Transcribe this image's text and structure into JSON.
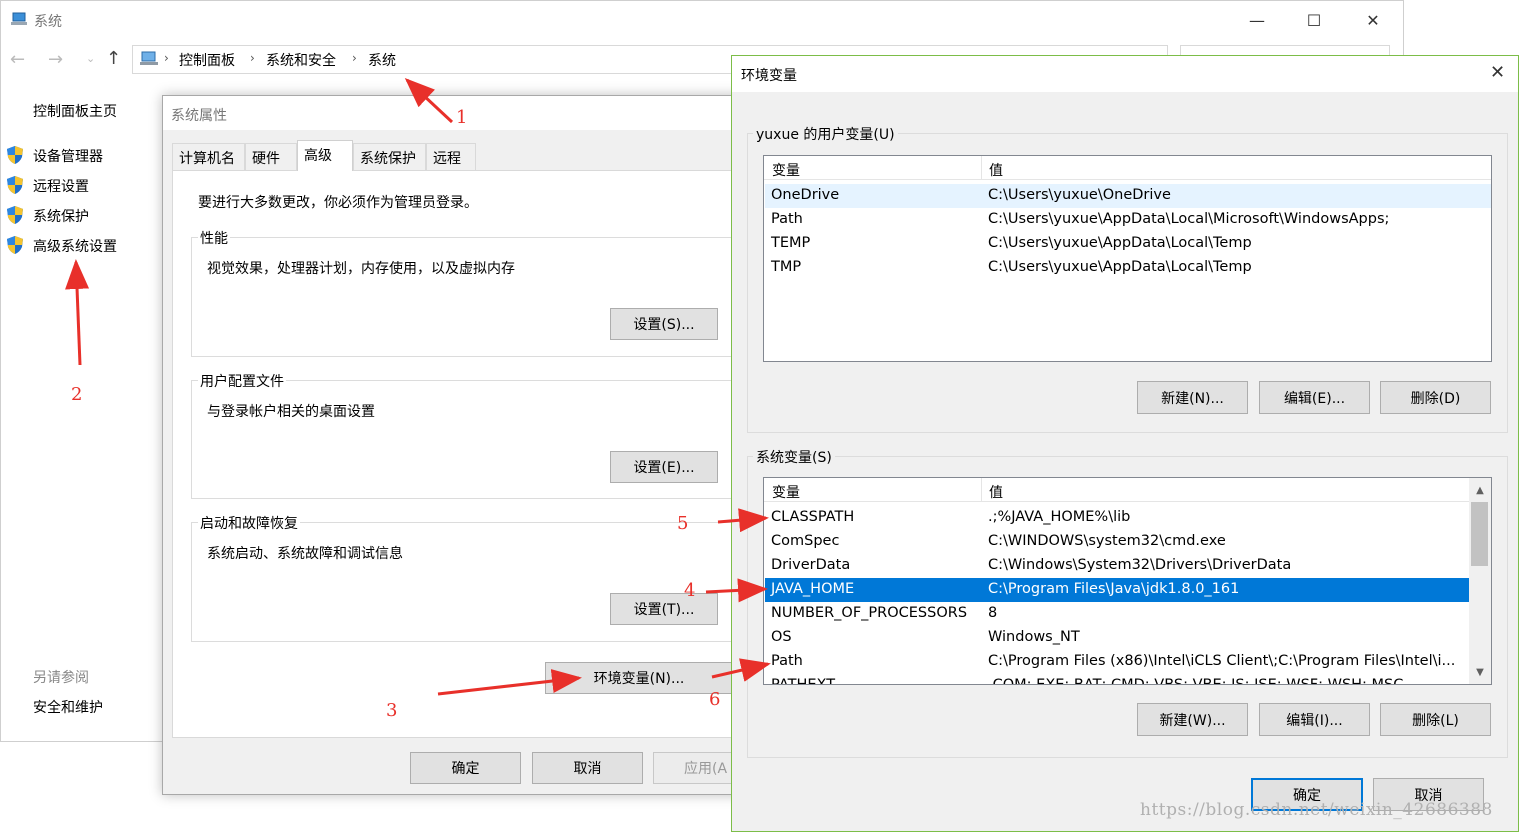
{
  "system_window": {
    "title": "系统",
    "breadcrumb": [
      "控制面板",
      "系统和安全",
      "系统"
    ],
    "sidebar": {
      "home": "控制面板主页",
      "items": [
        "设备管理器",
        "远程设置",
        "系统保护",
        "高级系统设置"
      ],
      "see_also": "另请参阅",
      "see_also_items": [
        "安全和维护"
      ]
    }
  },
  "system_properties": {
    "title": "系统属性",
    "tabs": [
      "计算机名",
      "硬件",
      "高级",
      "系统保护",
      "远程"
    ],
    "active_tab": "高级",
    "admin_note": "要进行大多数更改，你必须作为管理员登录。",
    "groups": [
      {
        "title": "性能",
        "desc": "视觉效果，处理器计划，内存使用，以及虚拟内存",
        "button": "设置(S)..."
      },
      {
        "title": "用户配置文件",
        "desc": "与登录帐户相关的桌面设置",
        "button": "设置(E)..."
      },
      {
        "title": "启动和故障恢复",
        "desc": "系统启动、系统故障和调试信息",
        "button": "设置(T)..."
      }
    ],
    "env_button": "环境变量(N)...",
    "ok": "确定",
    "cancel": "取消",
    "apply": "应用(A"
  },
  "env_vars": {
    "title": "环境变量",
    "user_group_title": "yuxue 的用户变量(U)",
    "col_variable": "变量",
    "col_value": "值",
    "user_vars": [
      {
        "name": "OneDrive",
        "value": "C:\\Users\\yuxue\\OneDrive"
      },
      {
        "name": "Path",
        "value": "C:\\Users\\yuxue\\AppData\\Local\\Microsoft\\WindowsApps;"
      },
      {
        "name": "TEMP",
        "value": "C:\\Users\\yuxue\\AppData\\Local\\Temp"
      },
      {
        "name": "TMP",
        "value": "C:\\Users\\yuxue\\AppData\\Local\\Temp"
      }
    ],
    "user_buttons": {
      "new": "新建(N)...",
      "edit": "编辑(E)...",
      "delete": "删除(D)"
    },
    "system_group_title": "系统变量(S)",
    "system_vars": [
      {
        "name": "CLASSPATH",
        "value": ".;%JAVA_HOME%\\lib"
      },
      {
        "name": "ComSpec",
        "value": "C:\\WINDOWS\\system32\\cmd.exe"
      },
      {
        "name": "DriverData",
        "value": "C:\\Windows\\System32\\Drivers\\DriverData"
      },
      {
        "name": "JAVA_HOME",
        "value": "C:\\Program Files\\Java\\jdk1.8.0_161"
      },
      {
        "name": "NUMBER_OF_PROCESSORS",
        "value": "8"
      },
      {
        "name": "OS",
        "value": "Windows_NT"
      },
      {
        "name": "Path",
        "value": "C:\\Program Files (x86)\\Intel\\iCLS Client\\;C:\\Program Files\\Intel\\i..."
      },
      {
        "name": "PATHEXT",
        "value": ".COM;.EXE;.BAT;.CMD;.VBS;.VBE;.JS;.JSE;.WSF;.WSH;.MSC"
      }
    ],
    "selected_system_var": "JAVA_HOME",
    "system_buttons": {
      "new": "新建(W)...",
      "edit": "编辑(I)...",
      "delete": "删除(L)"
    },
    "ok": "确定",
    "cancel": "取消"
  },
  "annotations": [
    "1",
    "2",
    "3",
    "4",
    "5",
    "6"
  ],
  "annotation_color": "#e8302a",
  "selection_color": "#0078d7",
  "watermark": "https://blog.csdn.net/weixin_42686388"
}
